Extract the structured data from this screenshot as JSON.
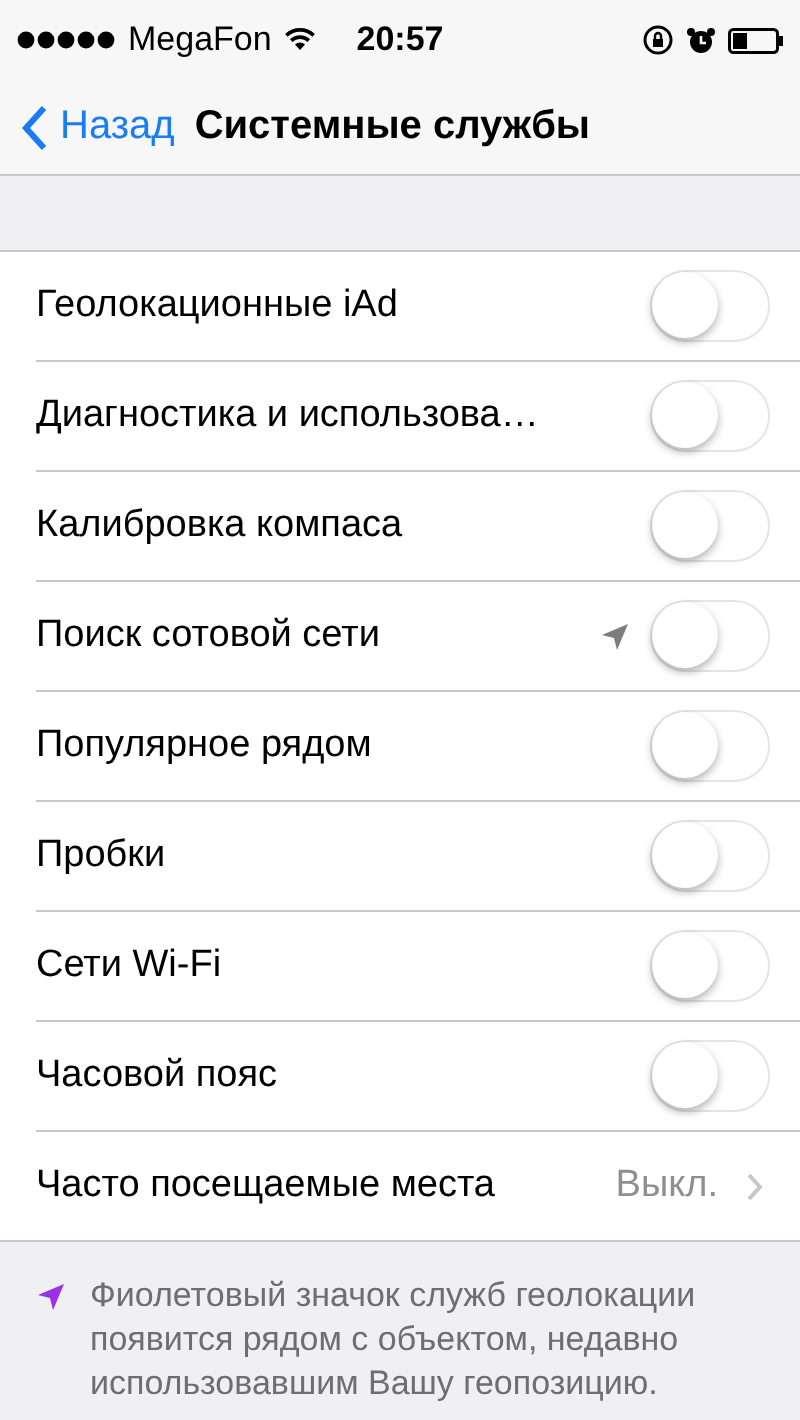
{
  "status_bar": {
    "carrier": "MegaFon",
    "time": "20:57"
  },
  "nav": {
    "back": "Назад",
    "title": "Системные службы"
  },
  "rows": [
    {
      "kind": "toggle",
      "label": "Геолокационные iAd",
      "on": false,
      "location_used": false
    },
    {
      "kind": "toggle",
      "label": "Диагностика и использова…",
      "on": false,
      "location_used": false
    },
    {
      "kind": "toggle",
      "label": "Калибровка компаса",
      "on": false,
      "location_used": false
    },
    {
      "kind": "toggle",
      "label": "Поиск сотовой сети",
      "on": false,
      "location_used": true
    },
    {
      "kind": "toggle",
      "label": "Популярное рядом",
      "on": false,
      "location_used": false
    },
    {
      "kind": "toggle",
      "label": "Пробки",
      "on": false,
      "location_used": false
    },
    {
      "kind": "toggle",
      "label": "Сети Wi-Fi",
      "on": false,
      "location_used": false
    },
    {
      "kind": "toggle",
      "label": "Часовой пояс",
      "on": false,
      "location_used": false
    },
    {
      "kind": "detail",
      "label": "Часто посещаемые места",
      "value": "Выкл."
    }
  ],
  "footer": {
    "text": "Фиолетовый значок служб геолокации появится рядом с объектом, недавно использовавшим Вашу геопозицию."
  }
}
